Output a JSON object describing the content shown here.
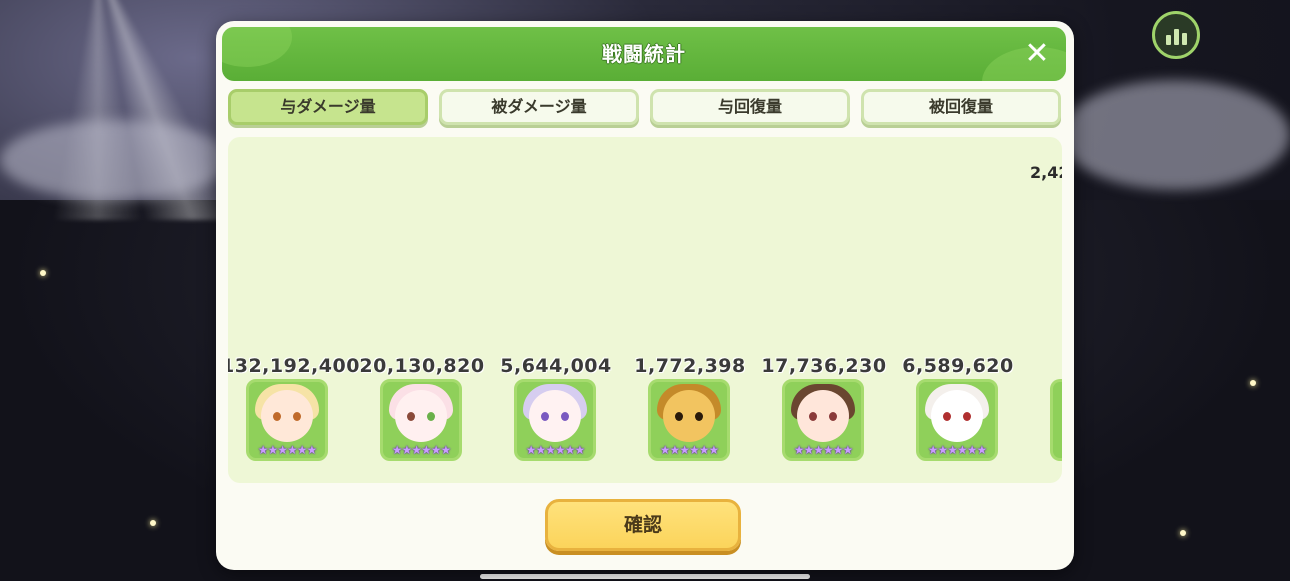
{
  "dialog": {
    "title": "戦闘統計",
    "close_icon": "✕",
    "tabs": [
      {
        "label": "与ダメージ量",
        "active": true
      },
      {
        "label": "被ダメージ量",
        "active": false
      },
      {
        "label": "与回復量",
        "active": false
      },
      {
        "label": "被回復量",
        "active": false
      }
    ],
    "overflow_value": "2,42",
    "heroes": [
      {
        "value": "132,192,400",
        "stars": "★★★★★★",
        "icon": "hero-portrait-blonde-icon"
      },
      {
        "value": "20,130,820",
        "stars": "★★★★★★",
        "icon": "hero-portrait-pink-icon"
      },
      {
        "value": "5,644,004",
        "stars": "★★★★★★",
        "icon": "hero-portrait-lavender-icon"
      },
      {
        "value": "1,772,398",
        "stars": "★★★★★★",
        "icon": "hero-portrait-bee-icon"
      },
      {
        "value": "17,736,230",
        "stars": "★★★★★★",
        "icon": "hero-portrait-brown-icon"
      },
      {
        "value": "6,589,620",
        "stars": "★★★★★★",
        "icon": "hero-portrait-white-icon"
      }
    ],
    "confirm_label": "確認"
  },
  "colors": {
    "title_green": "#5aae36",
    "active_tab": "#c6e48e",
    "panel": "#eef7d6",
    "confirm": "#fbd45b"
  }
}
